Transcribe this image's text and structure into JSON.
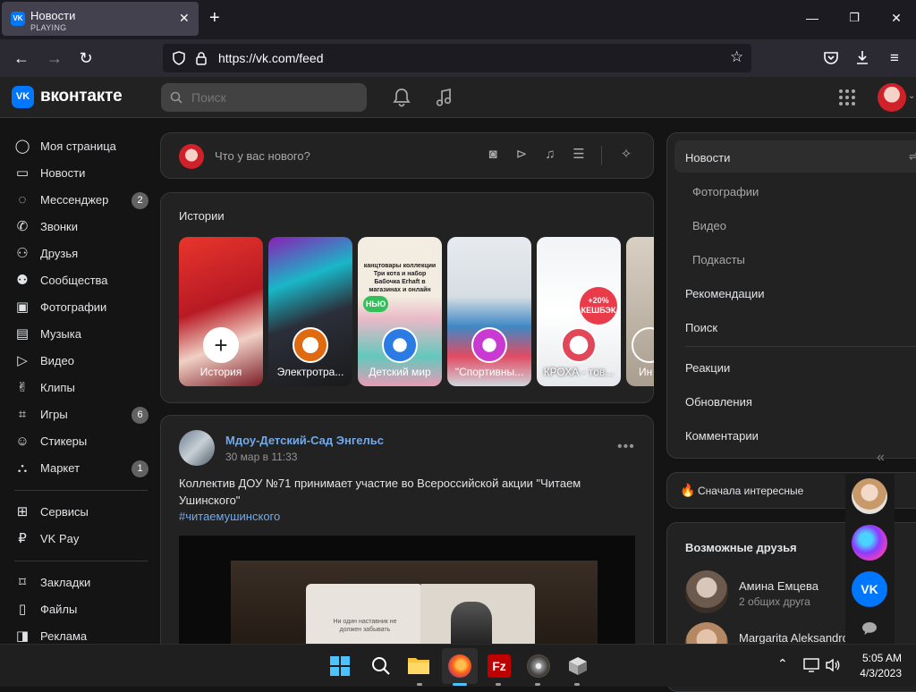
{
  "browser": {
    "tab_title": "Новости",
    "tab_subtitle": "PLAYING",
    "favicon": "VK",
    "url": "https://vk.com/feed"
  },
  "vk": {
    "brand": "вконтакте",
    "logo": "VK",
    "search_placeholder": "Поиск",
    "accent": "#0077ff"
  },
  "sidebar": {
    "items": [
      {
        "label": "Моя страница",
        "icon": "user-circle-icon"
      },
      {
        "label": "Новости",
        "icon": "news-icon"
      },
      {
        "label": "Мессенджер",
        "icon": "message-icon",
        "badge": "2"
      },
      {
        "label": "Звонки",
        "icon": "phone-icon"
      },
      {
        "label": "Друзья",
        "icon": "friends-icon"
      },
      {
        "label": "Сообщества",
        "icon": "communities-icon"
      },
      {
        "label": "Фотографии",
        "icon": "photo-icon"
      },
      {
        "label": "Музыка",
        "icon": "music-icon"
      },
      {
        "label": "Видео",
        "icon": "video-icon"
      },
      {
        "label": "Клипы",
        "icon": "clips-icon"
      },
      {
        "label": "Игры",
        "icon": "gamepad-icon",
        "badge": "6"
      },
      {
        "label": "Стикеры",
        "icon": "sticker-icon"
      },
      {
        "label": "Маркет",
        "icon": "market-icon",
        "badge": "1"
      }
    ],
    "items2": [
      {
        "label": "Сервисы",
        "icon": "services-icon"
      },
      {
        "label": "VK Pay",
        "icon": "vkpay-icon"
      }
    ],
    "items3": [
      {
        "label": "Закладки",
        "icon": "bookmark-icon"
      },
      {
        "label": "Файлы",
        "icon": "file-icon"
      },
      {
        "label": "Реклама",
        "icon": "ads-icon"
      }
    ]
  },
  "composer": {
    "placeholder": "Что у вас нового?"
  },
  "stories": {
    "title": "Истории",
    "items": [
      {
        "label": "История",
        "add": true
      },
      {
        "label": "Электротра..."
      },
      {
        "label": "Детский мир"
      },
      {
        "label": "\"Спортивны..."
      },
      {
        "label": "КРОХА - тов..."
      },
      {
        "label": "Ин"
      }
    ],
    "story2_text": "канцтовары коллекции Три кота и набор Бабочка Erhaft в магазинах и онлайн",
    "story2_badge": "НЬЮ",
    "story3_text": "+20% КЕШБЭК"
  },
  "post": {
    "author": "Мдоу-Детский-Сад Энгельс",
    "date": "30 мар в 11:33",
    "text": "Коллектив ДОУ №71 принимает участие во Всероссийской акции \"Читаем Ушинского\"",
    "hashtag": "#читаемушинского",
    "book_text": "Ни один наставник не должен забывать"
  },
  "right_menu": {
    "items": [
      "Новости",
      "Фотографии",
      "Видео",
      "Подкасты",
      "Рекомендации",
      "Поиск",
      "Реакции",
      "Обновления",
      "Комментарии"
    ],
    "sort": "Сначала интересные"
  },
  "friends": {
    "title": "Возможные друзья",
    "items": [
      {
        "name": "Амина Емцева",
        "mutual": "2 общих друга"
      },
      {
        "name": "Margarita Aleksandro",
        "mutual": ""
      }
    ]
  },
  "taskbar": {
    "time": "5:05 AM",
    "date": "4/3/2023"
  }
}
